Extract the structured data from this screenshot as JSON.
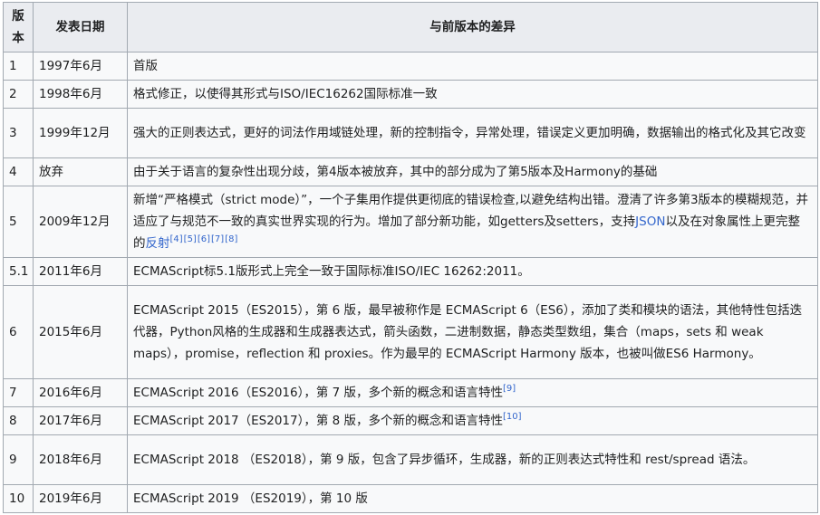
{
  "header": {
    "col_version": "版本",
    "col_date": "发表日期",
    "col_diff": "与前版本的差异"
  },
  "rows": [
    {
      "ver": "1",
      "date": "1997年6月",
      "text": "首版"
    },
    {
      "ver": "2",
      "date": "1998年6月",
      "text": "格式修正，以使得其形式与ISO/IEC16262国际标准一致"
    },
    {
      "ver": "3",
      "date": "1999年12月",
      "text": "强大的正则表达式，更好的词法作用域链处理，新的控制指令，异常处理，错误定义更加明确，数据输出的格式化及其它改变"
    },
    {
      "ver": "4",
      "date": "放弃",
      "text": "由于关于语言的复杂性出现分歧，第4版本被放弃，其中的部分成为了第5版本及Harmony的基础"
    },
    {
      "ver": "5",
      "date": "2009年12月",
      "text_a": "新增“严格模式（strict mode）”，一个子集用作提供更彻底的错误检查,以避免结构出错。澄清了许多第3版本的模糊规范，并适应了与规范不一致的真实世界实现的行为。增加了部分新功能，如getters及setters，支持",
      "link_json": "JSON",
      "text_b": "以及在对象属性上更完整的",
      "link_reflect": "反射",
      "refs": [
        "[4]",
        "[5]",
        "[6]",
        "[7]",
        "[8]"
      ]
    },
    {
      "ver": "5.1",
      "date": "2011年6月",
      "text": "ECMAScript标5.1版形式上完全一致于国际标准ISO/IEC 16262:2011。"
    },
    {
      "ver": "6",
      "date": "2015年6月",
      "text": "ECMAScript 2015（ES2015），第 6 版，最早被称作是 ECMAScript 6（ES6），添加了类和模块的语法，其他特性包括迭代器，Python风格的生成器和生成器表达式，箭头函数，二进制数据，静态类型数组，集合（maps，sets 和 weak maps），promise，reflection 和 proxies。作为最早的 ECMAScript Harmony 版本，也被叫做ES6 Harmony。"
    },
    {
      "ver": "7",
      "date": "2016年6月",
      "text": "ECMAScript 2016（ES2016），第 7 版，多个新的概念和语言特性",
      "ref": "[9]"
    },
    {
      "ver": "8",
      "date": "2017年6月",
      "text": "ECMAScript 2017（ES2017），第 8 版，多个新的概念和语言特性",
      "ref": "[10]"
    },
    {
      "ver": "9",
      "date": "2018年6月",
      "text": "ECMAScript 2018 （ES2018），第 9 版，包含了异步循环，生成器，新的正则表达式特性和 rest/spread 语法。"
    },
    {
      "ver": "10",
      "date": "2019年6月",
      "text": "ECMAScript 2019 （ES2019），第 10 版"
    }
  ]
}
